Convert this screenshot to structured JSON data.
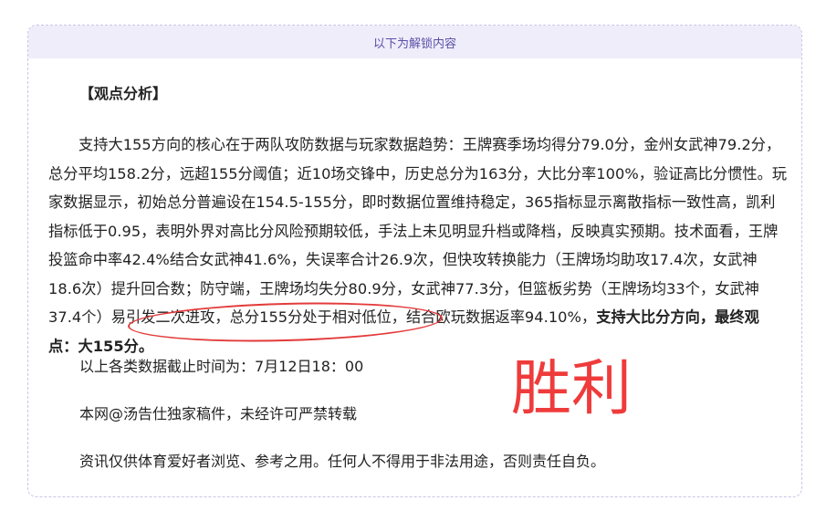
{
  "unlock_banner": {
    "text": "以下为解锁内容"
  },
  "analysis": {
    "title": "【观点分析】",
    "body_text": "支持大155方向的核心在于两队攻防数据与玩家数据趋势：王牌赛季场均得分79.0分，金州女武神79.2分，总分平均158.2分，远超155分阈值；近10场交锋中，历史总分为163分，大比分率100%，验证高比分惯性。玩家数据显示，初始总分普遍设在154.5-155分，即时数据位置维持稳定，365指标显示离散指标一致性高，凯利指标低于0.95，表明外界对高比分风险预期较低，手法上未见明显升档或降档，反映真实预期。技术面看，王牌投篮命中率42.4%结合女武神41.6%，失误率合计26.9次，但快攻转换能力（王牌场均助攻17.4次，女武神18.6次）提升回合数；防守端，王牌场均失分80.9分，女武神77.3分，但篮板劣势（王牌场均33个，女武神37.4个）易引发二次进攻，总分155分处于相对低位，结合欧玩数据返率94.10%，",
    "conclusion": "支持大比分方向，最终观点：大155分。"
  },
  "footer_lines": {
    "cutoff": "以上各类数据截止时间为：7月12日18：00",
    "copyright": "本网@汤告仕独家稿件，未经许可严禁转载",
    "disclaimer": "资讯仅供体育爱好者浏览、参考之用。任何人不得用于非法用途，否则责任自负。"
  },
  "stamp": {
    "text": "胜利",
    "color": "#ef3b3b"
  },
  "colors": {
    "banner_bg": "#efedfa",
    "banner_text": "#5a4fa8",
    "border": "#c9c4e4",
    "highlight_ellipse": "#e33a3a"
  }
}
